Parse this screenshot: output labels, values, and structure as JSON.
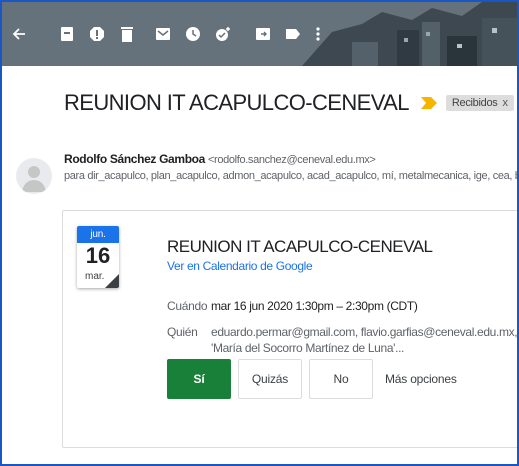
{
  "toolbar": {
    "icons": [
      "back-arrow-icon",
      "archive-icon",
      "report-spam-icon",
      "delete-icon",
      "mark-unread-icon",
      "snooze-icon",
      "add-to-tasks-icon",
      "move-to-icon",
      "labels-icon",
      "more-icon"
    ],
    "color": "#5f6b74"
  },
  "email": {
    "subject": "REUNION IT ACAPULCO-CENEVAL",
    "label_chip": "Recibidos",
    "label_close": "x",
    "sender_name": "Rodolfo Sánchez Gamboa",
    "sender_email": "<rodolfo.sanchez@ceneval.edu.mx>",
    "recipients": "para dir_acapulco, plan_acapulco, admon_acapulco, acad_acapulco, mí, metalmecanica, ige, cea, bioqui"
  },
  "invite": {
    "month": "jun.",
    "day": "16",
    "weekday": "mar.",
    "title": "REUNION IT ACAPULCO-CENEVAL",
    "calendar_link": "Ver en Calendario de Google",
    "when_label": "Cuándo",
    "when_value": "mar 16 jun 2020 1:30pm – 2:30pm (CDT)",
    "who_label": "Quién",
    "who_line1": "eduardo.permar@gmail.com, flavio.garfias@ceneval.edu.mx,",
    "who_line2": "'María del Socorro Martínez de Luna'...",
    "buttons": {
      "yes": "Sí",
      "maybe": "Quizás",
      "no": "No",
      "more": "Más opciones"
    }
  },
  "colors": {
    "accent_blue": "#1a73e8",
    "yes_green": "#188038",
    "importance_yellow": "#f4b400",
    "frame_border": "#1a56c4"
  }
}
